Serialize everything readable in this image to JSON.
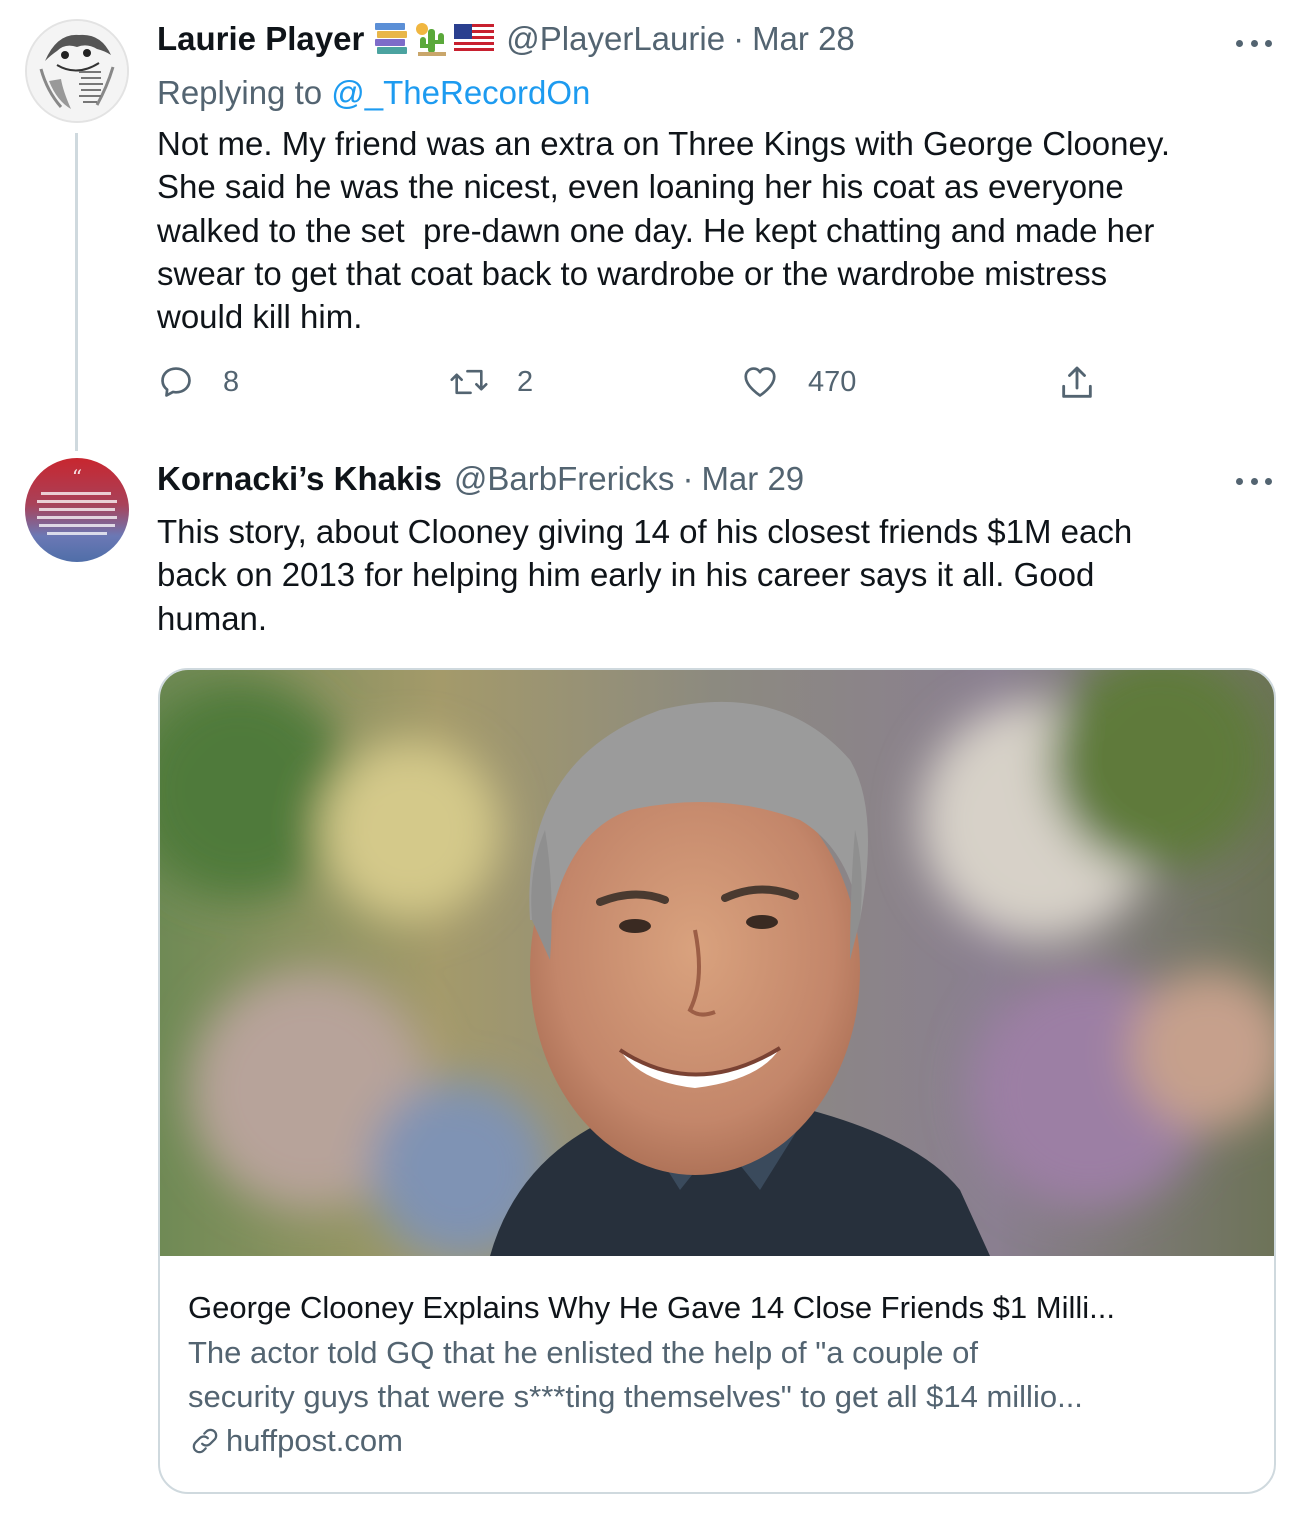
{
  "tweets": [
    {
      "author_name": "Laurie Player",
      "emojis": [
        "books-emoji",
        "cactus-emoji",
        "us-flag-emoji"
      ],
      "handle": "@PlayerLaurie",
      "separator": "·",
      "date": "Mar 28",
      "replying_prefix": "Replying to ",
      "replying_to": "@_TheRecordOn",
      "text_lines": [
        "Not me. My friend was an extra on Three Kings with George Clooney.",
        "She said he was the nicest, even loaning her his coat as everyone",
        "walked to the set  pre-dawn one day. He kept chatting and made her",
        "swear to get that coat back to wardrobe or the wardrobe mistress",
        "would kill him."
      ],
      "replies": "8",
      "retweets": "2",
      "likes": "470"
    },
    {
      "author_name": "Kornacki’s Khakis",
      "handle": "@BarbFrericks",
      "separator": "·",
      "date": "Mar 29",
      "text_lines": [
        "This story, about Clooney giving 14 of his closest friends $1M each",
        "back on 2013 for helping him early in his career says it all. Good",
        "human."
      ],
      "avatar_text": "May we think of freedom not as the right to do as we please, but as the opportunity to do what is right.",
      "card": {
        "title": "George Clooney Explains Why He Gave 14 Close Friends $1 Milli...",
        "description_lines": [
          "The actor told GQ that he enlisted the help of \"a couple of",
          "security guys that were s***ting themselves\" to get all $14 millio..."
        ],
        "domain": "huffpost.com"
      }
    }
  ],
  "colors": {
    "text_primary": "#0f1419",
    "text_secondary": "#536471",
    "link": "#1d9bf0",
    "border": "#cfd9de"
  }
}
